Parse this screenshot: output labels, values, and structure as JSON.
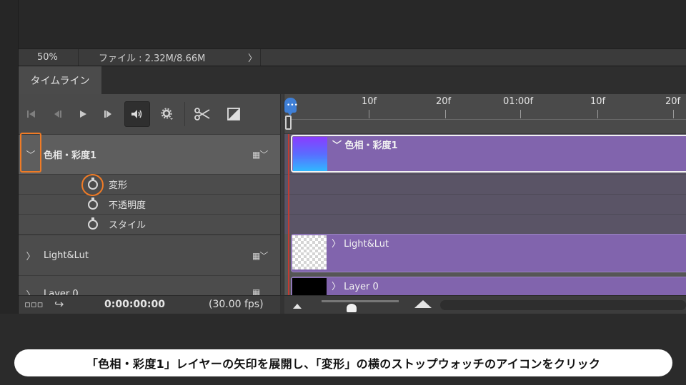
{
  "statusbar": {
    "zoom": "50%",
    "file_info": "ファイル : 2.32M/8.66M",
    "arrow": "〉"
  },
  "panel": {
    "tab_label": "タイムライン"
  },
  "transport": {
    "first_frame_icon": "first-frame-icon",
    "prev_frame_icon": "previous-frame-icon",
    "play_icon": "play-icon",
    "next_frame_icon": "next-frame-icon",
    "audio_icon": "speaker-icon",
    "settings_icon": "gear-icon",
    "split_icon": "scissors-icon",
    "transition_icon": "transition-icon"
  },
  "layers": [
    {
      "name": "色相・彩度1",
      "expanded": true,
      "chevron": "﹀",
      "properties": [
        "変形",
        "不透明度",
        "スタイル"
      ]
    },
    {
      "name": "Light&Lut",
      "expanded": false,
      "chevron": "〉"
    },
    {
      "name": "Layer 0",
      "expanded": false,
      "chevron": "〉"
    }
  ],
  "ruler": {
    "labels": [
      "10f",
      "20f",
      "01:00f",
      "10f",
      "20f"
    ]
  },
  "clips": {
    "hue": {
      "label": "﹀ 色相・彩度1"
    },
    "light": {
      "label": "〉 Light&Lut"
    },
    "layer0": {
      "label": "〉 Layer 0"
    }
  },
  "bottombar": {
    "timecode": "0:00:00:00",
    "fps": "(30.00 fps)"
  },
  "caption": "「色相・彩度1」レイヤーの矢印を展開し、「変形」の横のストップウォッチのアイコンをクリック",
  "colors": {
    "highlight": "#ef7b26",
    "clip": "#8164ad",
    "playhead": "#3f7fd6"
  }
}
